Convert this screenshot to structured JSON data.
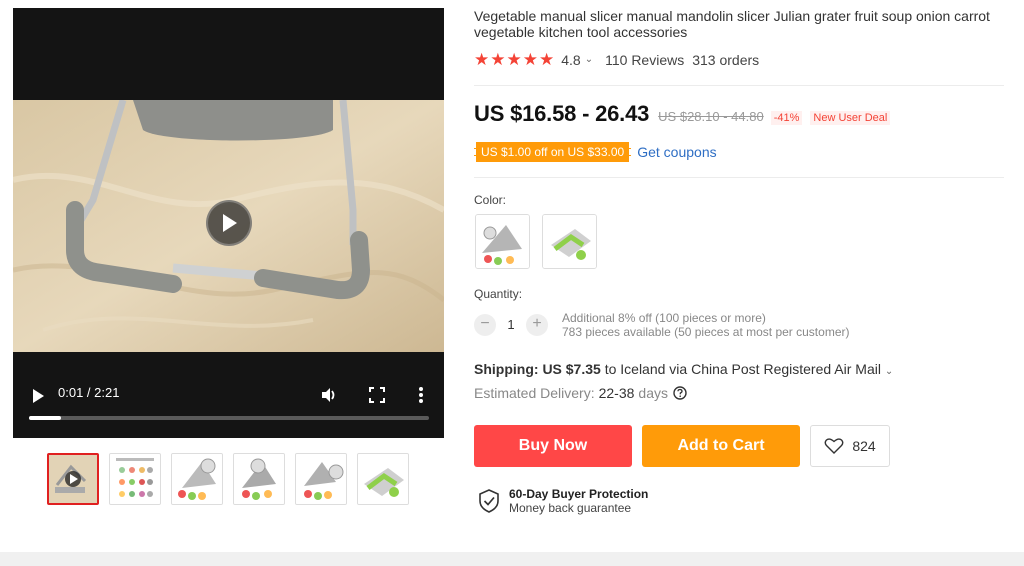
{
  "video": {
    "time": "0:01 / 2:21",
    "progress": 0.008
  },
  "product": {
    "title": "Vegetable manual slicer manual mandolin slicer Julian grater fruit soup onion carrot vegetable kitchen tool accessories",
    "rating": "4.8",
    "reviews": "110 Reviews",
    "orders": "313 orders",
    "price": "US $16.58 - 26.43",
    "original_price": "US $28.10 - 44.80",
    "discount": "-41%",
    "deal_badge": "New User Deal",
    "coupon": "US $1.00 off on US $33.00",
    "get_coupons": "Get coupons"
  },
  "options": {
    "color_label": "Color:",
    "quantity_label": "Quantity:",
    "quantity": "1",
    "minus": "−",
    "plus": "+",
    "qty_note": "Additional 8% off (100 pieces or more)",
    "availability": "783 pieces available (50 pieces at most per customer)"
  },
  "shipping": {
    "label": "Shipping:",
    "cost": "US $7.35",
    "destination": "to Iceland via China Post Registered Air Mail",
    "delivery_label": "Estimated Delivery:",
    "delivery_range": "22-38",
    "delivery_unit": "days"
  },
  "actions": {
    "buy_now": "Buy Now",
    "add_to_cart": "Add to Cart",
    "wishlist_count": "824"
  },
  "protection": {
    "title": "60-Day Buyer Protection",
    "subtitle": "Money back guarantee"
  },
  "colors": {
    "star": "#f44336",
    "buy": "#ff4747",
    "cart": "#ff9b09",
    "link": "#2e6ec4"
  }
}
